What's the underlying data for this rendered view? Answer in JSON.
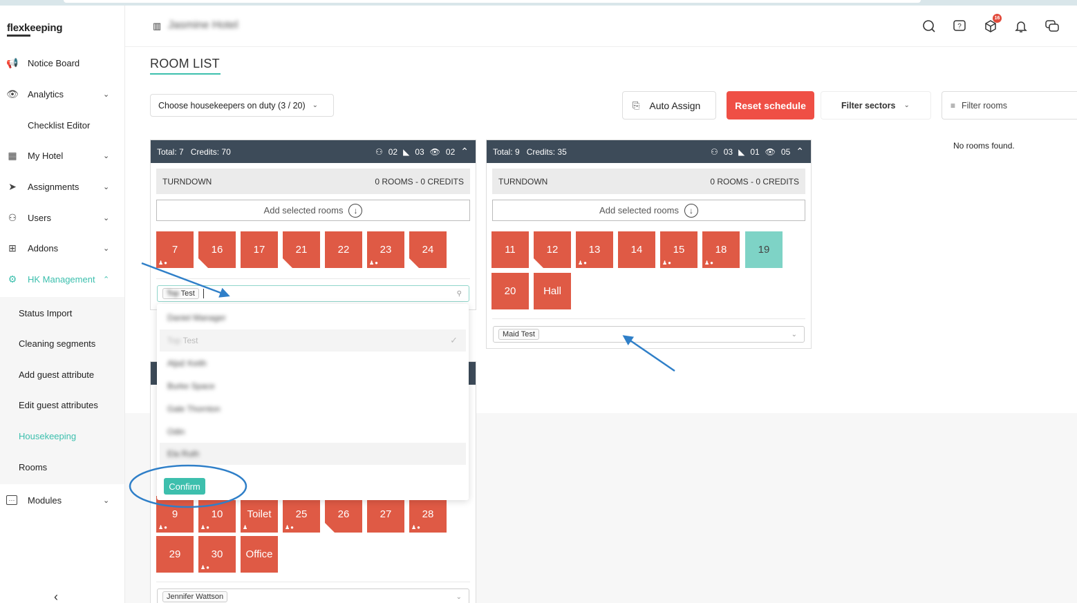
{
  "app": {
    "logo": "flexkeeping",
    "hotel_name": "Jasmine Hotel"
  },
  "sidebar": {
    "items": [
      {
        "label": "Notice Board",
        "icon": "megaphone-icon"
      },
      {
        "label": "Analytics",
        "icon": "eye-icon"
      },
      {
        "label": "Checklist Editor",
        "icon": ""
      },
      {
        "label": "My Hotel",
        "icon": "building-icon"
      },
      {
        "label": "Assignments",
        "icon": "send-icon"
      },
      {
        "label": "Users",
        "icon": "user-icon"
      },
      {
        "label": "Addons",
        "icon": "grid-icon"
      },
      {
        "label": "HK Management",
        "icon": "gear-icon"
      },
      {
        "label": "Modules",
        "icon": "dots-icon"
      }
    ],
    "sub_items": [
      "Status Import",
      "Cleaning segments",
      "Add guest attribute",
      "Edit guest attributes",
      "Housekeeping",
      "Rooms"
    ],
    "collapse_glyph": "‹"
  },
  "header": {
    "building_glyph": "🏢",
    "search_glyph": "○",
    "help_glyph": "?",
    "box_glyph": "⬡",
    "box_badge": "16",
    "bell_glyph": "🔔",
    "chat_glyph": "💬"
  },
  "main": {
    "title": "ROOM LIST",
    "choose_housekeepers": "Choose housekeepers on duty (3 / 20)",
    "auto_assign": "Auto Assign",
    "reset_schedule": "Reset schedule",
    "filter_sectors": "Filter sectors",
    "filter_rooms": "Filter rooms",
    "no_rooms": "No rooms found."
  },
  "panels": [
    {
      "total": "Total: 7",
      "credits": "Credits: 70",
      "stat_user": "02",
      "stat_flag": "03",
      "stat_eye": "02",
      "turndown": "TURNDOWN",
      "turndown_count": "0 ROOMS - 0 CREDITS",
      "add_selected": "Add selected rooms",
      "rooms": [
        "7",
        "16",
        "17",
        "21",
        "22",
        "23",
        "24"
      ],
      "select_chip": "Test"
    },
    {
      "total": "Total: 9",
      "credits": "Credits: 35",
      "stat_user": "03",
      "stat_flag": "01",
      "stat_eye": "05",
      "turndown": "TURNDOWN",
      "turndown_count": "0 ROOMS - 0 CREDITS",
      "add_selected": "Add selected rooms",
      "rooms": [
        "11",
        "12",
        "13",
        "14",
        "15",
        "18",
        "19",
        "20",
        "Hall"
      ],
      "select_chip": "Maid Test"
    },
    {
      "rooms": [
        "9",
        "10",
        "Toilet",
        "25",
        "26",
        "27",
        "28",
        "29",
        "30",
        "Office"
      ],
      "select_chip": "Jennifer Wattson"
    }
  ],
  "dropdown": {
    "items": [
      "Daniel Manager",
      "Test",
      "Aljaž Keith",
      "Burke Space",
      "Gale Thornton",
      "Odin",
      "Ela Ruth"
    ],
    "selected_prefix": "Top",
    "confirm": "Confirm"
  },
  "colors": {
    "accent": "#3bbfad",
    "room_red": "#df5a45",
    "room_teal": "#7ed3c6",
    "reset_red": "#ef4f45",
    "panel_header": "#3d4b59",
    "annotation": "#2f7fc8"
  }
}
